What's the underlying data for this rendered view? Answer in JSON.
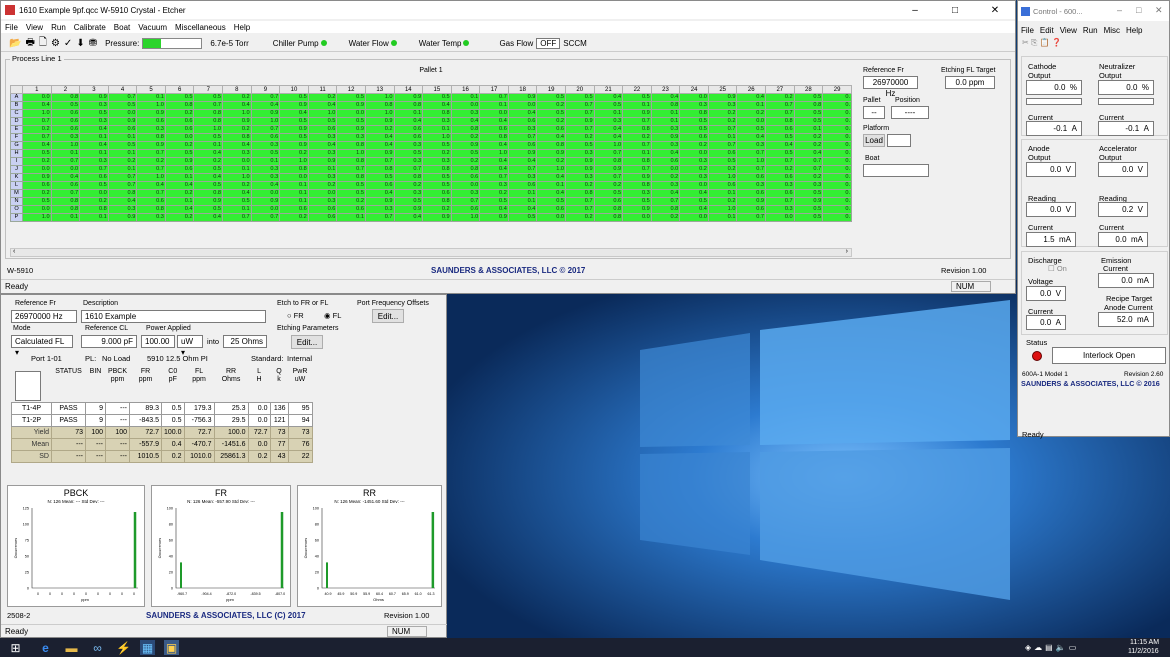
{
  "desktop": {
    "bg": "#1d4f86"
  },
  "etcher": {
    "title": "1610 Example 9pf.qcc W-5910 Crystal - Etcher",
    "menu": [
      "File",
      "View",
      "Run",
      "Calibrate",
      "Boat",
      "Vacuum",
      "Miscellaneous",
      "Help"
    ],
    "toolbar": {
      "pressure_label": "Pressure:",
      "pressure_value": "6.7e-5",
      "pressure_unit": "Torr",
      "chiller": "Chiller Pump",
      "water_flow": "Water Flow",
      "water_temp": "Water Temp",
      "gas_flow": "Gas Flow",
      "gas_value": "OFF",
      "gas_unit": "SCCM"
    },
    "process_line": "Process Line 1",
    "pallet": "Pallet 1",
    "columns": [
      "1",
      "2",
      "3",
      "4",
      "5",
      "6",
      "7",
      "8",
      "9",
      "10",
      "11",
      "12",
      "13",
      "14",
      "15",
      "16",
      "17",
      "18",
      "19",
      "20",
      "21",
      "22",
      "23",
      "24",
      "25",
      "26",
      "27",
      "28",
      "29"
    ],
    "rows": [
      {
        "id": "A",
        "vals": [
          "0.0",
          "0.8",
          "0.9",
          "0.7",
          "0.1",
          "0.5",
          "0.5",
          "0.2",
          "0.7",
          "0.5",
          "0.2",
          "0.5",
          "1.0",
          "0.9",
          "0.5",
          "0.1",
          "0.7",
          "0.9",
          "0.5",
          "0.5",
          "0.4",
          "0.5",
          "0.4",
          "0.0",
          "0.9",
          "0.4",
          "0.2",
          "0.5",
          "0."
        ]
      },
      {
        "id": "B",
        "vals": [
          "0.4",
          "0.5",
          "0.3",
          "0.5",
          "1.0",
          "0.8",
          "0.7",
          "0.4",
          "0.4",
          "0.9",
          "0.4",
          "0.9",
          "0.8",
          "0.8",
          "0.4",
          "0.0",
          "0.1",
          "0.0",
          "0.2",
          "0.7",
          "0.5",
          "0.1",
          "0.8",
          "0.3",
          "0.3",
          "0.1",
          "0.7",
          "0.8",
          "0."
        ]
      },
      {
        "id": "C",
        "vals": [
          "1.0",
          "0.6",
          "0.5",
          "0.0",
          "0.9",
          "0.2",
          "0.8",
          "1.0",
          "0.9",
          "0.4",
          "1.0",
          "0.0",
          "1.0",
          "0.1",
          "0.8",
          "0.3",
          "0.0",
          "0.4",
          "0.5",
          "0.7",
          "0.1",
          "0.9",
          "0.1",
          "0.8",
          "0.2",
          "0.2",
          "0.7",
          "0.5",
          "0."
        ]
      },
      {
        "id": "D",
        "vals": [
          "0.7",
          "0.6",
          "0.3",
          "0.9",
          "0.6",
          "0.6",
          "0.8",
          "0.9",
          "1.0",
          "0.5",
          "0.5",
          "0.5",
          "0.9",
          "0.4",
          "0.3",
          "0.4",
          "0.4",
          "0.6",
          "0.2",
          "0.9",
          "0.3",
          "0.7",
          "0.1",
          "0.5",
          "0.2",
          "0.0",
          "0.8",
          "0.5",
          "0."
        ]
      },
      {
        "id": "E",
        "vals": [
          "0.2",
          "0.6",
          "0.4",
          "0.6",
          "0.3",
          "0.6",
          "1.0",
          "0.2",
          "0.7",
          "0.9",
          "0.6",
          "0.9",
          "0.2",
          "0.6",
          "0.1",
          "0.8",
          "0.6",
          "0.3",
          "0.6",
          "0.7",
          "0.4",
          "0.8",
          "0.3",
          "0.5",
          "0.7",
          "0.5",
          "0.6",
          "0.1",
          "0."
        ]
      },
      {
        "id": "F",
        "vals": [
          "0.7",
          "0.3",
          "0.1",
          "0.1",
          "0.8",
          "0.0",
          "0.5",
          "0.8",
          "0.6",
          "0.5",
          "0.3",
          "0.3",
          "0.4",
          "0.6",
          "1.0",
          "0.2",
          "0.8",
          "0.7",
          "0.4",
          "0.2",
          "0.4",
          "0.2",
          "0.9",
          "0.6",
          "0.1",
          "0.4",
          "0.5",
          "0.2",
          "0."
        ]
      },
      {
        "id": "G",
        "vals": [
          "0.4",
          "1.0",
          "0.4",
          "0.5",
          "0.9",
          "0.2",
          "0.1",
          "0.4",
          "0.3",
          "0.9",
          "0.4",
          "0.8",
          "0.4",
          "0.3",
          "0.5",
          "0.9",
          "0.4",
          "0.6",
          "0.8",
          "0.5",
          "1.0",
          "0.7",
          "0.3",
          "0.2",
          "0.7",
          "0.3",
          "0.4",
          "0.2",
          "0."
        ]
      },
      {
        "id": "H",
        "vals": [
          "0.5",
          "0.1",
          "0.1",
          "0.1",
          "0.7",
          "0.5",
          "0.4",
          "0.3",
          "0.5",
          "0.2",
          "0.3",
          "1.0",
          "0.9",
          "0.5",
          "0.2",
          "0.5",
          "1.0",
          "0.9",
          "0.9",
          "0.3",
          "0.7",
          "0.1",
          "0.4",
          "0.0",
          "0.6",
          "0.7",
          "0.5",
          "0.4",
          "0."
        ]
      },
      {
        "id": "I",
        "vals": [
          "0.2",
          "0.7",
          "0.3",
          "0.2",
          "0.2",
          "0.9",
          "0.2",
          "0.0",
          "0.1",
          "1.0",
          "0.9",
          "0.8",
          "0.7",
          "0.3",
          "0.3",
          "0.2",
          "0.4",
          "0.4",
          "0.2",
          "0.9",
          "0.8",
          "0.8",
          "0.6",
          "0.3",
          "0.5",
          "1.0",
          "0.7",
          "0.7",
          "0."
        ]
      },
      {
        "id": "J",
        "vals": [
          "0.0",
          "0.0",
          "0.7",
          "0.1",
          "0.7",
          "0.6",
          "0.5",
          "0.1",
          "0.3",
          "0.8",
          "0.1",
          "0.7",
          "0.8",
          "0.7",
          "0.8",
          "0.8",
          "0.4",
          "0.7",
          "1.0",
          "0.9",
          "0.9",
          "0.7",
          "0.0",
          "0.2",
          "0.2",
          "0.7",
          "0.2",
          "0.7",
          "0."
        ]
      },
      {
        "id": "K",
        "vals": [
          "0.9",
          "0.4",
          "0.6",
          "0.7",
          "1.0",
          "0.1",
          "0.4",
          "1.0",
          "0.3",
          "0.0",
          "0.3",
          "0.8",
          "0.5",
          "0.8",
          "0.5",
          "0.6",
          "0.7",
          "0.3",
          "0.4",
          "0.3",
          "0.7",
          "0.9",
          "0.2",
          "0.3",
          "1.0",
          "0.6",
          "0.6",
          "0.2",
          "0."
        ]
      },
      {
        "id": "L",
        "vals": [
          "0.6",
          "0.6",
          "0.5",
          "0.7",
          "0.4",
          "0.4",
          "0.5",
          "0.2",
          "0.4",
          "0.1",
          "0.2",
          "0.5",
          "0.6",
          "0.2",
          "0.5",
          "0.0",
          "0.3",
          "0.6",
          "0.1",
          "0.2",
          "0.2",
          "0.8",
          "0.3",
          "0.0",
          "0.6",
          "0.3",
          "0.3",
          "0.3",
          "0."
        ]
      },
      {
        "id": "M",
        "vals": [
          "0.2",
          "0.7",
          "0.0",
          "0.8",
          "0.7",
          "0.2",
          "0.8",
          "0.4",
          "0.0",
          "0.1",
          "0.0",
          "0.5",
          "0.4",
          "0.3",
          "0.6",
          "0.3",
          "0.2",
          "0.1",
          "0.4",
          "0.8",
          "0.5",
          "0.3",
          "0.4",
          "0.4",
          "0.1",
          "0.6",
          "0.6",
          "0.5",
          "0."
        ]
      },
      {
        "id": "N",
        "vals": [
          "0.5",
          "0.8",
          "0.2",
          "0.4",
          "0.6",
          "0.1",
          "0.9",
          "0.5",
          "0.9",
          "0.1",
          "0.3",
          "0.2",
          "0.9",
          "0.5",
          "0.8",
          "0.7",
          "0.5",
          "0.1",
          "0.5",
          "0.7",
          "0.6",
          "0.5",
          "0.7",
          "0.5",
          "0.2",
          "0.9",
          "0.7",
          "0.9",
          "0."
        ]
      },
      {
        "id": "O",
        "vals": [
          "0.0",
          "0.8",
          "0.8",
          "0.3",
          "0.8",
          "0.4",
          "0.5",
          "0.1",
          "0.0",
          "0.6",
          "0.6",
          "0.6",
          "0.3",
          "0.9",
          "0.2",
          "0.6",
          "0.4",
          "0.4",
          "0.6",
          "0.7",
          "0.8",
          "0.9",
          "0.8",
          "0.4",
          "1.0",
          "0.6",
          "0.3",
          "0.5",
          "0."
        ]
      },
      {
        "id": "P",
        "vals": [
          "1.0",
          "0.1",
          "0.1",
          "0.9",
          "0.3",
          "0.2",
          "0.4",
          "0.7",
          "0.7",
          "0.2",
          "0.6",
          "0.1",
          "0.7",
          "0.4",
          "0.9",
          "1.0",
          "0.9",
          "0.5",
          "0.0",
          "0.2",
          "0.8",
          "0.0",
          "0.2",
          "0.0",
          "0.1",
          "0.7",
          "0.0",
          "0.5",
          "0."
        ]
      }
    ],
    "reference_fr_label": "Reference Fr",
    "reference_fr": "26970000",
    "reference_fr_unit": "Hz",
    "etching_fl_label": "Etching FL Target",
    "etching_fl": "0.0",
    "etching_fl_unit": "ppm",
    "pallet_label": "Pallet",
    "pallet_value": "--",
    "position_label": "Position",
    "position_value": "----",
    "platform_label": "Platform",
    "load_button": "Load",
    "boat_label": "Boat",
    "footer_left": "W-5910",
    "footer_center": "SAUNDERS & ASSOCIATES, LLC © 2017",
    "footer_right": "Revision 1.00",
    "status": "Ready",
    "num": "NUM"
  },
  "measure": {
    "reference_fr_label": "Reference Fr",
    "reference_fr": "26970000",
    "reference_fr_unit": "Hz",
    "description_label": "Description",
    "description": "1610 Example",
    "etch_label": "Etch to FR or FL",
    "fr_opt": "FR",
    "fl_opt": "FL",
    "port_offsets_label": "Port Frequency Offsets",
    "edit": "Edit...",
    "mode_label": "Mode",
    "mode": "Calculated FL",
    "ref_cl_label": "Reference CL",
    "ref_cl": "9.000",
    "ref_cl_unit": "pF",
    "power_label": "Power Applied",
    "power": "100.00",
    "power_unit": "uW",
    "into": "into",
    "ohms": "25",
    "ohms_unit": "Ohms",
    "etching_params_label": "Etching Parameters",
    "port": "Port 1-01",
    "pl_label": "PL:",
    "pl_value": "No Load",
    "model": "5910 12.5 Ohm PI",
    "standard": "Standard:",
    "internal": "Internal",
    "headers": [
      [
        "STATUS",
        ""
      ],
      [
        "BIN",
        ""
      ],
      [
        "PBCK",
        "ppm"
      ],
      [
        "FR",
        "ppm"
      ],
      [
        "C0",
        "pF"
      ],
      [
        "FL",
        "ppm"
      ],
      [
        "RR",
        "Ohms"
      ],
      [
        "L",
        "H"
      ],
      [
        "Q",
        "k"
      ],
      [
        "PwR",
        "uW"
      ]
    ],
    "data_rows": [
      {
        "label": "T1-4P",
        "vals": [
          "PASS",
          "9",
          "---",
          "89.3",
          "0.5",
          "179.3",
          "25.3",
          "0.0",
          "136",
          "95"
        ]
      },
      {
        "label": "T1-2P",
        "vals": [
          "PASS",
          "9",
          "---",
          "-843.5",
          "0.5",
          "-756.3",
          "29.5",
          "0.0",
          "121",
          "94"
        ]
      },
      {
        "label": "Yield",
        "vals": [
          "73",
          "100",
          "100",
          "72.7",
          "100.0",
          "72.7",
          "100.0",
          "72.7",
          "73",
          "73"
        ]
      },
      {
        "label": "Mean",
        "vals": [
          "---",
          "---",
          "---",
          "-557.9",
          "0.4",
          "-470.7",
          "-1451.6",
          "0.0",
          "77",
          "76"
        ]
      },
      {
        "label": "SD",
        "vals": [
          "---",
          "---",
          "---",
          "1010.5",
          "0.2",
          "1010.0",
          "25861.3",
          "0.2",
          "43",
          "22"
        ]
      }
    ],
    "charts": [
      {
        "title": "PBCK",
        "sub": "N: 126 Mean: --- Std Dev: ---",
        "xlabel": "ppm",
        "ylabel": "Occurrences",
        "ticks_y": [
          "125",
          "100",
          "75",
          "50",
          "25",
          "0"
        ],
        "ticks_x": [
          "0",
          "0",
          "0",
          "0",
          "0",
          "0",
          "0",
          "0",
          "0"
        ]
      },
      {
        "title": "FR",
        "sub": "N: 126 Mean: -557.90 Std Dev: ---",
        "xlabel": "ppm",
        "ylabel": "Occurrences",
        "ticks_y": [
          "100",
          "80",
          "60",
          "40",
          "20",
          "0"
        ],
        "ticks_x": [
          "-960.7",
          "-904.4",
          "-872.0",
          "-839.5",
          "-807.0"
        ]
      },
      {
        "title": "RR",
        "sub": "N: 126 Mean: -1451.60 Std Dev: ---",
        "xlabel": "Ohms",
        "ylabel": "Occurrences",
        "ticks_y": [
          "100",
          "80",
          "60",
          "40",
          "20",
          "0"
        ],
        "ticks_x": [
          "40.9",
          "45.9",
          "50.9",
          "55.9",
          "60.4",
          "60.7",
          "65.9",
          "61.0",
          "61.3"
        ]
      }
    ],
    "footer_left": "2508-2",
    "footer_center": "SAUNDERS & ASSOCIATES, LLC (C) 2017",
    "footer_right": "Revision 1.00",
    "status": "Ready",
    "num": "NUM"
  },
  "control": {
    "title": "Control - 600...",
    "menu": [
      "File",
      "Edit",
      "View",
      "Run",
      "Misc",
      "Help"
    ],
    "cathode": "Cathode",
    "neutralizer": "Neutralizer",
    "output": "Output",
    "cathode_out": "0.0",
    "cathode_out_unit": "%",
    "neut_out": "0.0",
    "neut_out_unit": "%",
    "current": "Current",
    "cathode_cur": "-0.1",
    "cathode_cur_unit": "A",
    "neut_cur": "-0.1",
    "neut_cur_unit": "A",
    "anode": "Anode",
    "accelerator": "Accelerator",
    "anode_out": "0.0",
    "anode_out_unit": "V",
    "acc_out": "0.0",
    "acc_out_unit": "V",
    "reading": "Reading",
    "anode_read": "0.0",
    "anode_read_unit": "V",
    "acc_read": "0.2",
    "acc_read_unit": "V",
    "anode_cur": "1.5",
    "anode_cur_unit": "mA",
    "acc_cur": "0.0",
    "acc_cur_unit": "mA",
    "discharge": "Discharge",
    "on": "On",
    "emission": "Emission",
    "emission_cur": "0.0",
    "emission_cur_unit": "mA",
    "voltage": "Voltage",
    "disch_volt": "0.0",
    "disch_volt_unit": "V",
    "recipe_target": "Recipe Target",
    "anode_current": "Anode Current",
    "recipe_val": "52.0",
    "recipe_unit": "mA",
    "disch_cur": "0.0",
    "disch_cur_unit": "A",
    "status_label": "Status",
    "interlock": "Interlock Open",
    "model": "600A-1 Model 1",
    "revision": "Revision 2.60",
    "company": "SAUNDERS & ASSOCIATES, LLC © 2016",
    "ready": "Ready"
  },
  "taskbar": {
    "time": "11:15 AM",
    "date": "11/2/2016"
  }
}
